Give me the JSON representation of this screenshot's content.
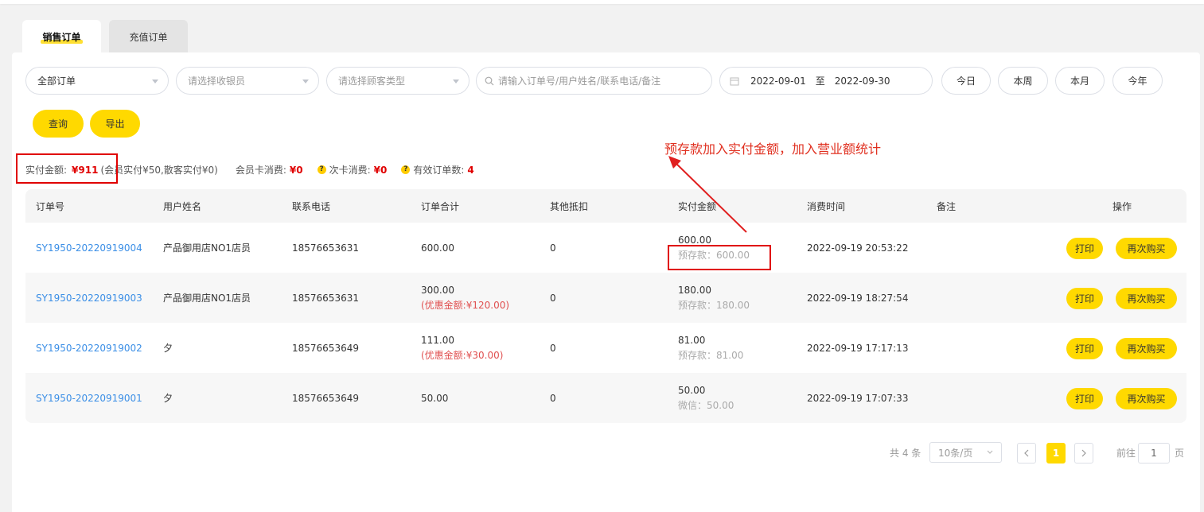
{
  "tabs": [
    {
      "label": "销售订单"
    },
    {
      "label": "充值订单"
    }
  ],
  "filters": {
    "order_type": "全部订单",
    "cashier_placeholder": "请选择收银员",
    "customer_type_placeholder": "请选择顾客类型",
    "search_placeholder": "请输入订单号/用户姓名/联系电话/备注",
    "date_start": "2022-09-01",
    "date_sep": "至",
    "date_end": "2022-09-30",
    "quick": [
      "今日",
      "本周",
      "本月",
      "今年"
    ]
  },
  "actions": {
    "query": "查询",
    "export": "导出"
  },
  "summary": {
    "paid_label": "实付金额:",
    "paid_value": "¥911",
    "paid_detail": "(会员实付¥50,散客实付¥0)",
    "card_label": "会员卡消费:",
    "card_value": "¥0",
    "times_label": "次卡消费:",
    "times_value": "¥0",
    "valid_label": "有效订单数:",
    "valid_value": "4"
  },
  "annotation": "预存款加入实付金额，加入营业额统计",
  "table": {
    "headers": [
      "订单号",
      "用户姓名",
      "联系电话",
      "订单合计",
      "其他抵扣",
      "实付金额",
      "消费时间",
      "备注",
      "操作"
    ],
    "rows": [
      {
        "order_no": "SY1950-20220919004",
        "name": "产品御用店NO1店员",
        "phone": "18576653631",
        "total": "600.00",
        "total_note": "",
        "deduct": "0",
        "paid": "600.00",
        "paid_note": "预存款：600.00",
        "time": "2022-09-19 20:53:22",
        "remark": "",
        "print": "打印",
        "rebuy": "再次购买"
      },
      {
        "order_no": "SY1950-20220919003",
        "name": "产品御用店NO1店员",
        "phone": "18576653631",
        "total": "300.00",
        "total_note": "(优惠金额:¥120.00)",
        "deduct": "0",
        "paid": "180.00",
        "paid_note": "预存款：180.00",
        "time": "2022-09-19 18:27:54",
        "remark": "",
        "print": "打印",
        "rebuy": "再次购买"
      },
      {
        "order_no": "SY1950-20220919002",
        "name": "夕",
        "phone": "18576653649",
        "total": "111.00",
        "total_note": "(优惠金额:¥30.00)",
        "deduct": "0",
        "paid": "81.00",
        "paid_note": "预存款：81.00",
        "time": "2022-09-19 17:17:13",
        "remark": "",
        "print": "打印",
        "rebuy": "再次购买"
      },
      {
        "order_no": "SY1950-20220919001",
        "name": "夕",
        "phone": "18576653649",
        "total": "50.00",
        "total_note": "",
        "deduct": "0",
        "paid": "50.00",
        "paid_note": "微信：50.00",
        "time": "2022-09-19 17:07:33",
        "remark": "",
        "print": "打印",
        "rebuy": "再次购买"
      }
    ]
  },
  "pagination": {
    "total": "共 4 条",
    "page_size": "10条/页",
    "current": "1",
    "goto_label": "前往",
    "goto_value": "1",
    "page_unit": "页"
  }
}
